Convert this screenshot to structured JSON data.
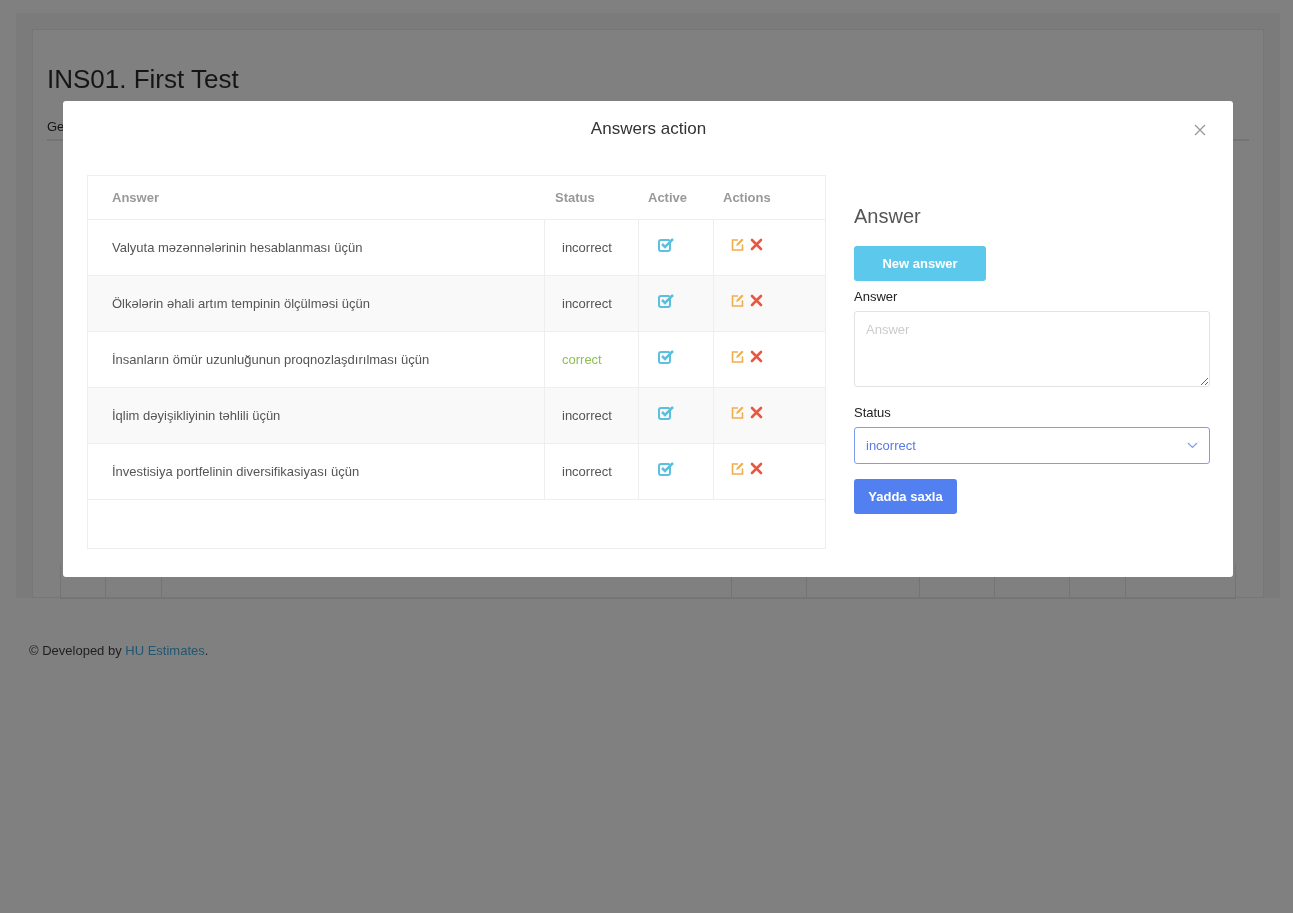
{
  "page": {
    "title": "INS01. First Test",
    "tab_fragment": "Ge"
  },
  "modal": {
    "title": "Answers action",
    "table": {
      "columns": [
        "Answer",
        "Status",
        "Active",
        "Actions"
      ],
      "rows": [
        {
          "answer": "Valyuta məzənnələrinin hesablanması üçün",
          "status": "incorrect",
          "kind": "incorrect",
          "active": true
        },
        {
          "answer": "Ölkələrin əhali artım tempinin ölçülməsi üçün",
          "status": "incorrect",
          "kind": "incorrect",
          "active": true
        },
        {
          "answer": "İnsanların ömür uzunluğunun proqnozlaşdırılması üçün",
          "status": "correct",
          "kind": "correct",
          "active": true
        },
        {
          "answer": "İqlim dəyişikliyinin təhlili üçün",
          "status": "incorrect",
          "kind": "incorrect",
          "active": true
        },
        {
          "answer": "İnvestisiya portfelinin diversifikasiyası üçün",
          "status": "incorrect",
          "kind": "incorrect",
          "active": true
        }
      ]
    },
    "form": {
      "heading": "Answer",
      "new_button": "New answer",
      "answer_label": "Answer",
      "answer_placeholder": "Answer",
      "status_label": "Status",
      "status_value": "incorrect",
      "save_button": "Yadda saxla"
    }
  },
  "footer": {
    "prefix": "© Developed by ",
    "link": "HU Estimates",
    "suffix": "."
  }
}
